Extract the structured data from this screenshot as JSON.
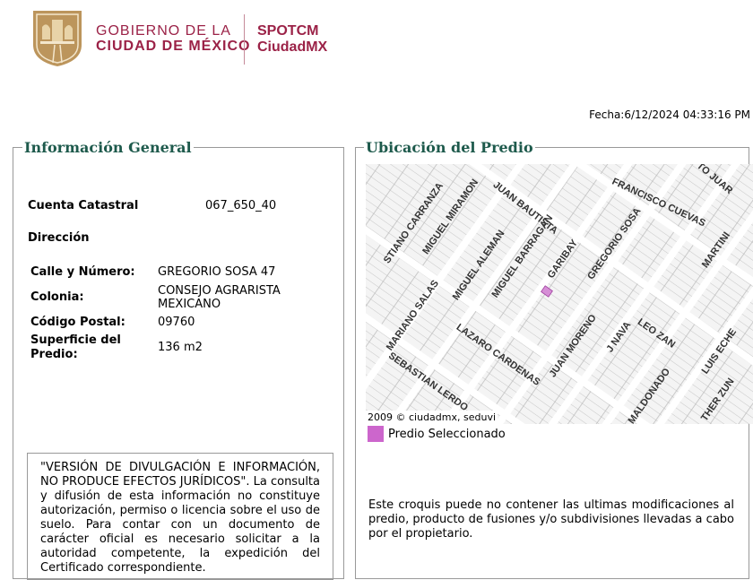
{
  "header": {
    "gov_line1": "GOBIERNO DE LA",
    "gov_line2": "CIUDAD DE MÉXICO",
    "app_line1": "SPOTCM",
    "app_line2": "CiudadMX",
    "fecha": "Fecha:6/12/2024 04:33:16 PM",
    "colors": {
      "brand": "#9b2247",
      "shield": "#bc955c",
      "legend": "#1e5a4c"
    }
  },
  "info_general": {
    "title": "Información General",
    "cuenta_label": "Cuenta Catastral",
    "cuenta_value": "067_650_40",
    "direccion_label": "Dirección",
    "calle_label": "Calle y Número:",
    "calle_value": "GREGORIO SOSA 47",
    "colonia_label": "Colonia:",
    "colonia_value_1": "CONSEJO AGRARISTA",
    "colonia_value_2": "MEXICANO",
    "cp_label": "Código Postal:",
    "cp_value": "09760",
    "superficie_label_1": "Superficie del",
    "superficie_label_2": "Predio:",
    "superficie_value": "136 m2",
    "disclaimer": "\"VERSIÓN DE DIVULGACIÓN E INFORMACIÓN, NO PRODUCE EFECTOS JURÍDICOS\". La consulta y difusión de esta información no constituye autorización, permiso o licencia sobre el uso de suelo. Para contar con un documento de carácter oficial es necesario solicitar a la autoridad competente, la expedición del Certificado correspondiente."
  },
  "ubicacion": {
    "title": "Ubicación del Predio",
    "streets": [
      "STIANO CARRANZA",
      "MIGUEL MIRAMON",
      "JUAN BAUTISTA",
      "FRANCISCO CUEVAS",
      "TO JUAR",
      "GREGORIO SOSA",
      "GARIBAY",
      "MIGUEL BARRAGAN",
      "MIGUEL ALEMAN",
      "MARIANO SALAS",
      "MARTINI",
      "LAZARO CARDENAS",
      "SEBASTIAN LERDO",
      "JUAN MORENO",
      "J NAVA",
      "LEO ZAN",
      "MALDONADO",
      "LUIS ECHE",
      "THER ZUN"
    ],
    "copyright": "2009 © ciudadmx, seduvi",
    "legend_label": "Predio Seleccionado",
    "legend_color": "#cc66cc",
    "note": "Este croquis puede no contener las ultimas modificaciones al predio, producto de fusiones y/o subdivisiones llevadas a cabo por el propietario."
  }
}
